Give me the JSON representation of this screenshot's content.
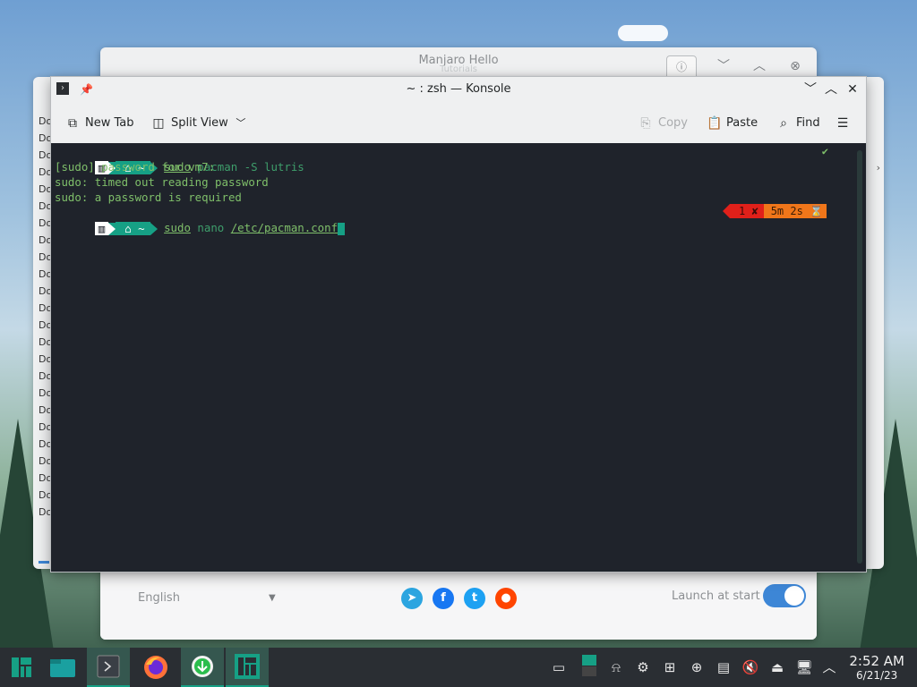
{
  "hello_window": {
    "title": "Manjaro Hello",
    "subtitle": "Tutorials",
    "info_icon": "info-icon",
    "language": "English",
    "launch_label": "Launch at start",
    "launch_enabled": true,
    "social": [
      "telegram",
      "facebook",
      "twitter",
      "reddit"
    ]
  },
  "list_window": {
    "items": [
      "Do",
      "Do",
      "Do",
      "Do",
      "Do",
      "Do",
      "Do",
      "Do",
      "Do",
      "Do",
      "Do",
      "Do",
      "Do",
      "Do",
      "Do",
      "Do",
      "Do",
      "Do",
      "Do",
      "Do",
      "Do",
      "Do",
      "Do",
      "Do"
    ]
  },
  "konsole": {
    "title": "~ : zsh — Konsole",
    "toolbar": {
      "new_tab": "New Tab",
      "split_view": "Split View",
      "copy": "Copy",
      "paste": "Paste",
      "find": "Find"
    },
    "terminal": {
      "prompt_dir": "~",
      "cmd1_sudo": "sudo",
      "cmd1_rest": " pacman -S lutris",
      "out1": "[sudo] password for vm7:",
      "out2": "sudo: timed out reading password",
      "out3": "sudo: a password is required",
      "cmd2_sudo": "sudo",
      "cmd2_mid": " nano ",
      "cmd2_path": "/etc/pacman.conf",
      "ok_mark": "✔",
      "err_status": "1 ✘",
      "duration": "5m 2s ⌛"
    }
  },
  "taskbar": {
    "apps": [
      "manjaro-menu",
      "file-manager",
      "konsole",
      "firefox",
      "software-update",
      "manjaro-hello"
    ],
    "time": "2:52 AM",
    "date": "6/21/23"
  },
  "colors": {
    "accent": "#16a085",
    "terminal_bg": "#1f232b",
    "error": "#e0201a",
    "duration": "#f0761a"
  }
}
